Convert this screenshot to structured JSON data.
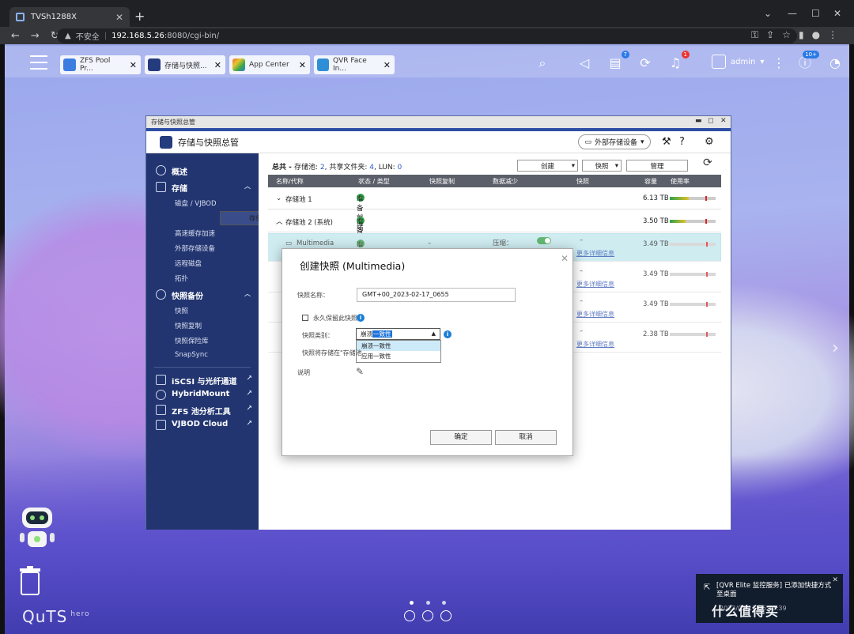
{
  "browser": {
    "tab_title": "TVSh1288X",
    "url_warning": "不安全",
    "url_host": "192.168.5.26",
    "url_rest": ":8080/cgi-bin/"
  },
  "qts_tabs": [
    {
      "label": "ZFS Pool Pr...",
      "color": "#3c7de0"
    },
    {
      "label": "存储与快照...",
      "color": "#243b7d"
    },
    {
      "label": "App Center",
      "color": "#f06b34"
    },
    {
      "label": "QVR Face In...",
      "color": "#2f8fd6"
    }
  ],
  "top_badges": {
    "tasks": "7",
    "notifications": "1",
    "updates": "10+"
  },
  "user": {
    "name": "admin"
  },
  "window": {
    "titlebar": "存储与快照总管",
    "app_title": "存储与快照总管",
    "external_button": "外部存储设备"
  },
  "sidebar": {
    "overview": "概述",
    "storage": "存储",
    "disks": "磁盘 / VJBOD",
    "storage_snapshots": "存储/快照",
    "cache": "高速缓存加速",
    "external": "外部存储设备",
    "remote_disk": "远程磁盘",
    "topology": "拓扑",
    "snapshot_backup": "快照备份",
    "snapshot": "快照",
    "snapshot_replica": "快照复制",
    "snapshot_vault": "快照保险库",
    "snapsync": "SnapSync",
    "iscsi": "iSCSI 与光纤通道",
    "hybridmount": "HybridMount",
    "zfs_tool": "ZFS 池分析工具",
    "vjbod_cloud": "VJBOD Cloud"
  },
  "content": {
    "summary_prefix": "总共 - ",
    "summary_pools_label": "存储池: ",
    "summary_pools": "2",
    "summary_shares_label": ", 共享文件夹: ",
    "summary_shares": "4",
    "summary_lun_label": ", LUN: ",
    "summary_lun": "0",
    "create_btn": "创建",
    "snapshot_btn": "快照",
    "manage_btn": "管理",
    "headers": {
      "name": "名称/代称",
      "status": "状态 / 类型",
      "replica": "快照复制",
      "reduction": "数据减少",
      "snapshot": "快照",
      "capacity": "容量",
      "usage": "使用率"
    },
    "pool1": {
      "name": "存储池 1",
      "status": "准备就绪",
      "capacity": "6.13 TB"
    },
    "pool2": {
      "name": "存储池 2 (系统)",
      "status": "准备就绪",
      "capacity": "3.50 TB"
    },
    "rows": [
      {
        "name": "Multimedia",
        "status": "准备就绪",
        "replica": "–",
        "reduction": "压缩：",
        "snapshot": "–",
        "more": "更多详细信息",
        "capacity": "3.49 TB"
      },
      {
        "snapshot": "–",
        "more": "更多详细信息",
        "capacity": "3.49 TB"
      },
      {
        "snapshot": "–",
        "more": "更多详细信息",
        "capacity": "3.49 TB"
      },
      {
        "snapshot": "–",
        "more": "更多详细信息",
        "capacity": "2.38 TB"
      }
    ]
  },
  "dialog": {
    "title": "创建快照 (Multimedia)",
    "name_label": "快照名称：",
    "name_value": "GMT+00_2023-02-17_0655",
    "keep_forever": "永久保留此快照",
    "type_label": "快照类别：",
    "type_selected_prefix": "崩溃",
    "type_selected_highlight": "一致性",
    "options": [
      "崩溃一致性",
      "应用一致性"
    ],
    "stored_text": "快照将存储在\"存储池",
    "desc_label": "说明",
    "ok": "确定",
    "cancel": "取消"
  },
  "notification": {
    "text": "[QVR Elite 监控服务] 已添加快捷方式至桌面",
    "time": "2023/02/17 06:33:39"
  },
  "brand": {
    "name": "QuTS",
    "sup": "hero"
  },
  "watermark": "什么值得买"
}
